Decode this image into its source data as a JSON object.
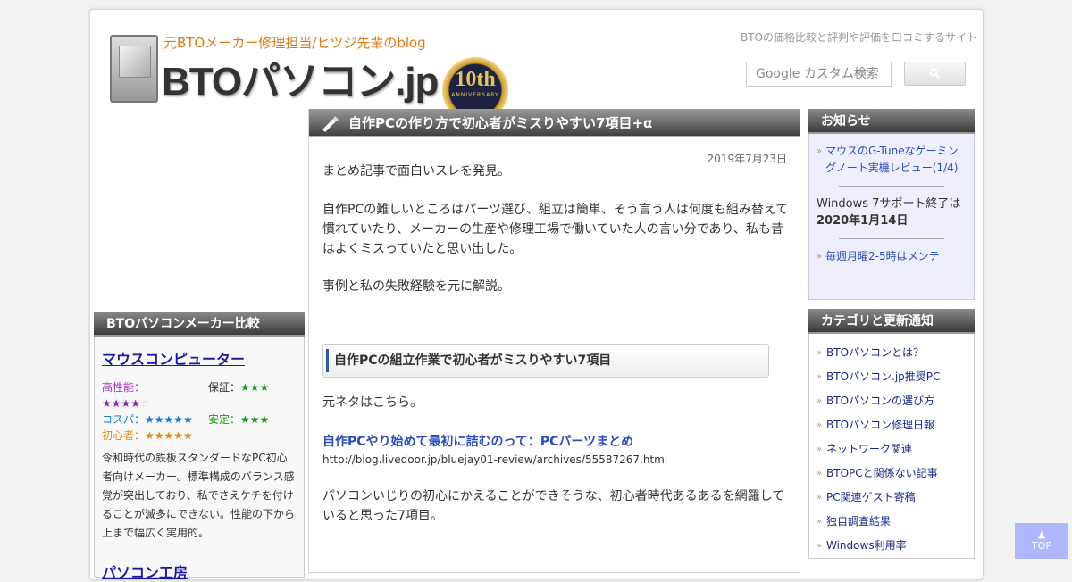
{
  "header": {
    "logo_sub": "元BTOメーカー修理担当/ヒツジ先輩のblog",
    "logo_main": "BTOパソコン.jp",
    "badge_num": "10th",
    "badge_text": "ANNIVERSARY",
    "tagline": "BTOの価格比較と評判や評価を口コミするサイト",
    "search_placeholder": "Google カスタム検索"
  },
  "left": {
    "title": "BTOパソコンメーカー比較",
    "maker1": {
      "name": "マウスコンピューター",
      "perf_label": "高性能：",
      "perf_stars": "★★★★",
      "perf_empty": "☆",
      "warranty_label": "保証：",
      "warranty_stars": "★★★",
      "cospa_label": "コスパ：",
      "cospa_stars": "★★★★★",
      "stable_label": "安定：",
      "stable_stars": "★★★",
      "beginner_label": "初心者：",
      "beginner_stars": "★★★★★",
      "desc": "令和時代の鉄板スタンダードなPC初心者向けメーカー。標準構成のバランス感覚が突出しており、私でさえケチを付けることが滅多にできない。性能の下から上まで幅広く実用的。"
    },
    "maker2": {
      "name": "パソコン工房"
    }
  },
  "article": {
    "title": "自作PCの作り方で初心者がミスりやすい7項目+α",
    "date": "2019年7月23日",
    "p1": "まとめ記事で面白いスレを発見。",
    "p2": "自作PCの難しいところはパーツ選び、組立は簡単、そう言う人は何度も組み替えて慣れていたり、メーカーの生産や修理工場で働いていた人の言い分であり、私も昔はよくミスっていたと思い出した。",
    "p3": "事例と私の失敗経験を元に解説。",
    "h2": "自作PCの組立作業で初心者がミスりやすい7項目",
    "p4": "元ネタはこちら。",
    "src_link": "自作PCやり始めて最初に詰むのって：PCパーツまとめ",
    "src_url": "http://blog.livedoor.jp/bluejay01-review/archives/55587267.html",
    "p5": "パソコンいじりの初心にかえることができそうな、初心者時代あるあるを網羅していると思った7項目。"
  },
  "right": {
    "notice_title": "お知らせ",
    "notice_link1": "マウスのG-Tuneなゲーミングノート実機レビュー(1/4)",
    "notice_text1": "Windows 7サポート終了は",
    "notice_text2": "2020年1月14日",
    "notice_link2": "毎週月曜2-5時はメンテ",
    "cat_title": "カテゴリと更新通知",
    "categories": [
      "BTOパソコンとは？",
      "BTOパソコン.jp推奨PC",
      "BTOパソコンの選び方",
      "BTOパソコン修理日報",
      "ネットワーク関連",
      "BTOPCと関係ない記事",
      "PC関連ゲスト寄稿",
      "独自調査結果",
      "Windows利用率"
    ]
  },
  "top_button": {
    "arrow": "▲",
    "label": "TOP"
  },
  "colors": {
    "link": "#2a4ec0",
    "accent_orange": "#e07a15",
    "notice_bg": "#eeeefc",
    "top_btn": "#a8b0ff"
  }
}
